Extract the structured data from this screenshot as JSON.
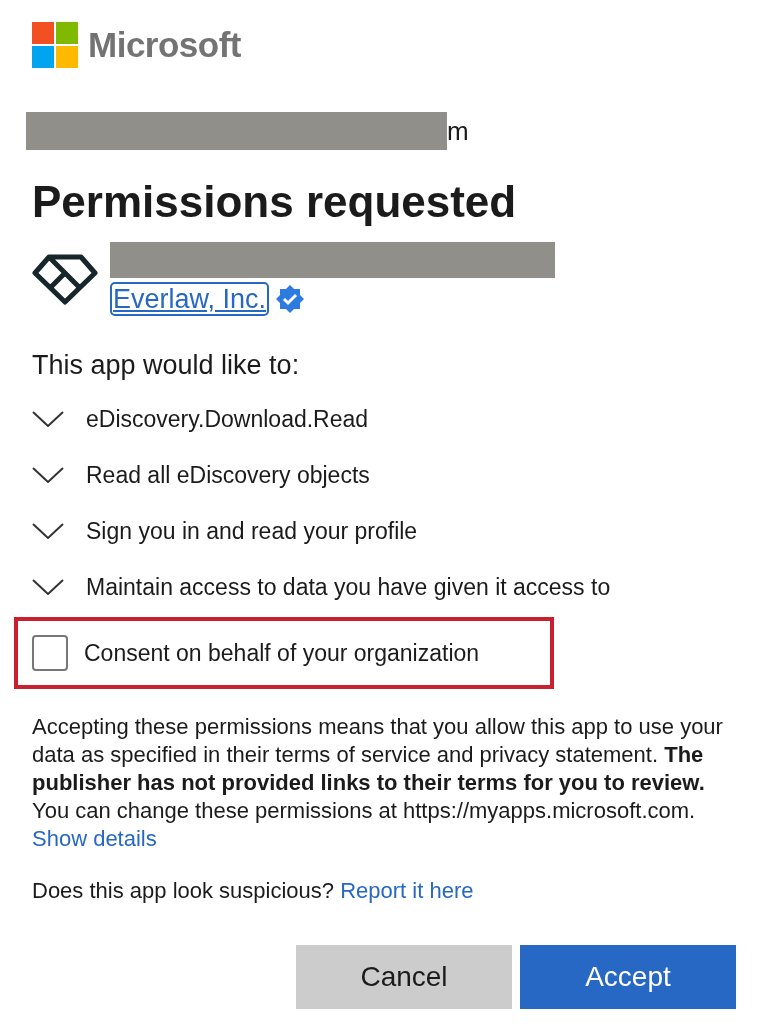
{
  "brand": {
    "name": "Microsoft"
  },
  "account": {
    "text": "m"
  },
  "title": "Permissions requested",
  "app": {
    "publisher": "Everlaw, Inc.",
    "verified": true
  },
  "intro": "This app would like to:",
  "permissions": [
    {
      "label": "eDiscovery.Download.Read",
      "expanded": false
    },
    {
      "label": "Read all eDiscovery objects",
      "expanded": false
    },
    {
      "label": "Sign you in and read your profile",
      "expanded": false
    },
    {
      "label": "Maintain access to data you have given it access to",
      "expanded": false
    }
  ],
  "consent": {
    "label": "Consent on behalf of your organization",
    "checked": false
  },
  "notice": {
    "text": "Accepting these permissions means that you allow this app to use your data as specified in their terms of service and privacy statement. **The publisher has not provided links to their terms for you to review.** You can change these permissions at https://myapps.microsoft.com.",
    "link": "Show details"
  },
  "suspicious": {
    "text": "Does this app look suspicious?",
    "link": "Report it here"
  },
  "buttons": [
    {
      "label": "Cancel",
      "kind": "secondary"
    },
    {
      "label": "Accept",
      "kind": "primary"
    }
  ]
}
